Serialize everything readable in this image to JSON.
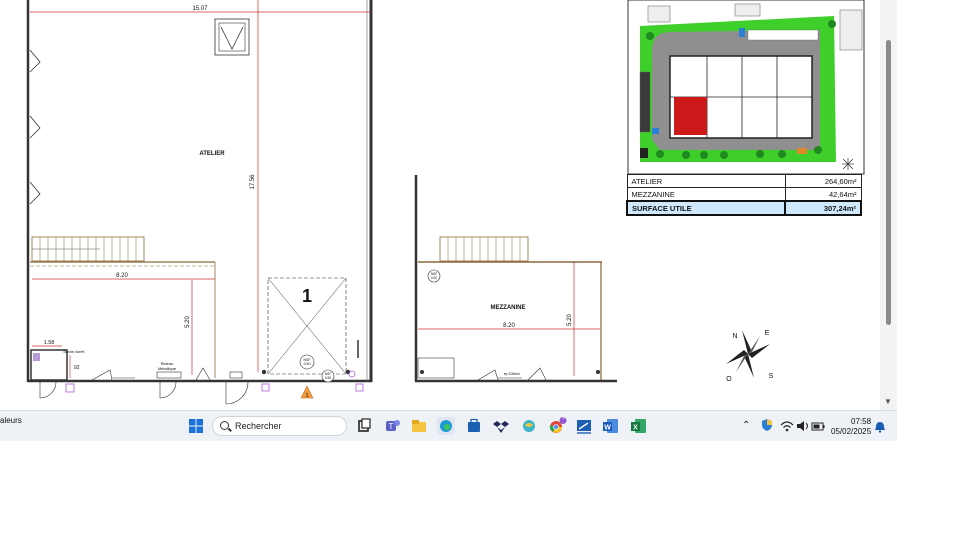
{
  "plan": {
    "dim_width_top": "15.07",
    "label_atelier": "ATELIER",
    "dim_height_atelier": "17.56",
    "dim_width_820_left": "8.20",
    "dim_520_left": "5.20",
    "dim_158": "1.58",
    "label_door_note": "Bande d'arrêt",
    "dim_92": "92",
    "label_rideau": "Rideau",
    "label_metallique": "Métallique",
    "door_number": "1",
    "nsf_left": "NSF",
    "nsf_left_val": "0.50",
    "nsf_small": "NSF",
    "nsf_small_val": "0.50",
    "label_mezzanine": "MEZZANINE",
    "dim_width_820_right": "8.20",
    "dim_520_right": "5.20",
    "nsf_mezz": "NSF",
    "nsf_mezz_val": "0.00",
    "marker_small": "1",
    "bottom_small_note": "ep 100mm",
    "compass_letters": [
      "N",
      "E",
      "S",
      "O"
    ]
  },
  "surfaces": {
    "rows": [
      {
        "name": "ATELIER",
        "value": "264,60m²"
      },
      {
        "name": "MEZZANINE",
        "value": "42,64m²"
      }
    ],
    "total": {
      "name": "SURFACE UTILE",
      "value": "307,24m²"
    }
  },
  "taskbar": {
    "left_text": "aleurs",
    "search_placeholder": "Rechercher",
    "time": "07:58",
    "date": "05/02/2025",
    "chrome_badge": "9",
    "apps": [
      "windows-start-icon",
      "task-view-icon",
      "teams-icon",
      "file-explorer-icon",
      "edge-icon",
      "store-icon",
      "dropbox-icon",
      "browser-icon",
      "chrome-icon",
      "whiteboard-icon",
      "word-icon",
      "excel-icon"
    ]
  },
  "colors": {
    "dimension_red": "#d03030",
    "highlight_lot": "#cc1a1a",
    "site_green": "#3fcf2a",
    "total_row_blue": "#cfe8fb"
  }
}
